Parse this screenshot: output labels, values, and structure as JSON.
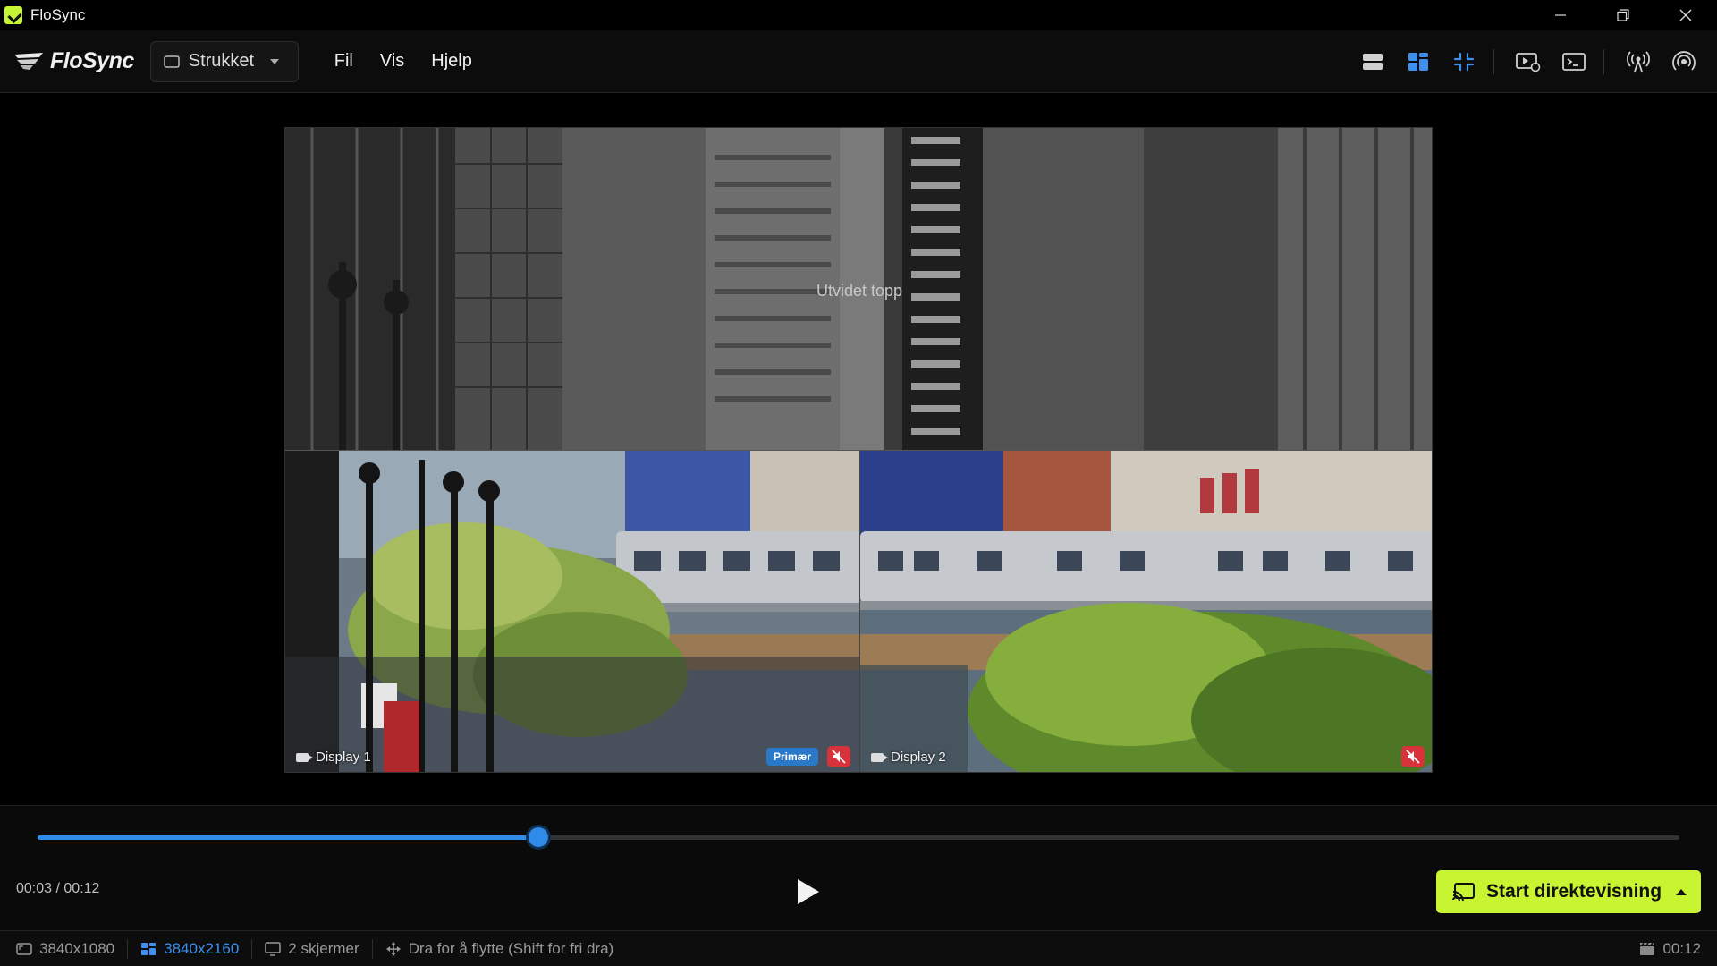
{
  "window": {
    "title": "FloSync"
  },
  "menubar": {
    "logo_text": "FloSync",
    "mode_select": {
      "value": "Strukket"
    },
    "menus": [
      "Fil",
      "Vis",
      "Hjelp"
    ]
  },
  "preview": {
    "extended_top_label": "Utvidet topp",
    "displays": [
      {
        "label": "Display 1",
        "badge": "Primær",
        "muted": true
      },
      {
        "label": "Display 2",
        "muted": true
      }
    ]
  },
  "playback": {
    "current_time": "00:03",
    "separator": " / ",
    "total_time": "00:12",
    "progress_fraction": 0.305,
    "live_button_label": "Start direktevisning"
  },
  "statusbar": {
    "items": [
      "3840x1080",
      "3840x2160",
      "2 skjermer",
      "Dra for å flytte (Shift for fri dra)"
    ],
    "active_index": 1,
    "right_time": "00:12"
  },
  "colors": {
    "accent": "#2f8ae8",
    "live": "#c8f432",
    "mute": "#d8323c",
    "primary_badge": "#2a78c8"
  },
  "icons": {
    "toolbar": [
      "layout-rows-icon",
      "layout-grid-icon",
      "collapse-icon",
      "video-settings-icon",
      "terminal-icon",
      "broadcast-icon",
      "signal-icon"
    ]
  }
}
